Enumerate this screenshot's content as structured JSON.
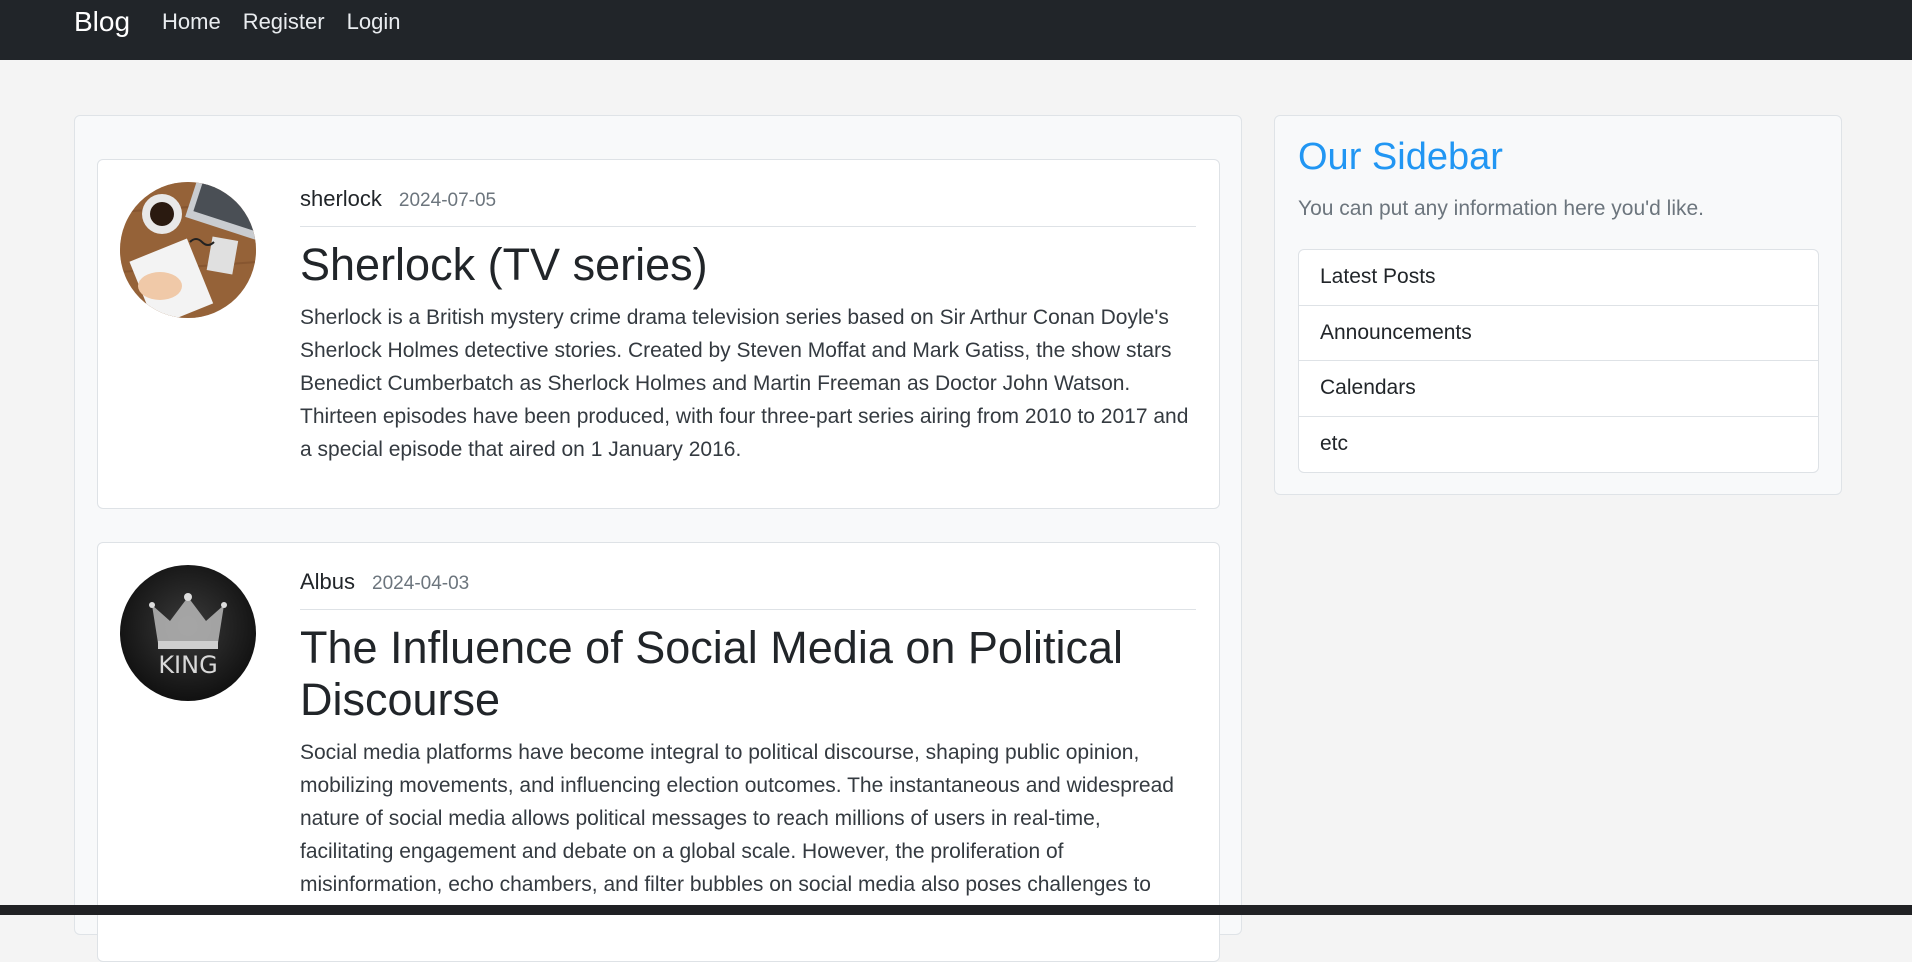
{
  "navbar": {
    "brand": "Blog",
    "links": [
      "Home",
      "Register",
      "Login"
    ]
  },
  "posts": [
    {
      "author": "sherlock",
      "date": "2024-07-05",
      "title": "Sherlock (TV series)",
      "content": "Sherlock is a British mystery crime drama television series based on Sir Arthur Conan Doyle's Sherlock Holmes detective stories. Created by Steven Moffat and Mark Gatiss, the show stars Benedict Cumberbatch as Sherlock Holmes and Martin Freeman as Doctor John Watson. Thirteen episodes have been produced, with four three-part series airing from 2010 to 2017 and a special episode that aired on 1 January 2016.",
      "avatar": "desk-photo"
    },
    {
      "author": "Albus",
      "date": "2024-04-03",
      "title": "The Influence of Social Media on Political Discourse",
      "content": "Social media platforms have become integral to political discourse, shaping public opinion, mobilizing movements, and influencing election outcomes. The instantaneous and widespread nature of social media allows political messages to reach millions of users in real-time, facilitating engagement and debate on a global scale. However, the proliferation of misinformation, echo chambers, and filter bubbles on social media also poses challenges to",
      "avatar": "crown-king-logo",
      "avatar_text": "KING"
    }
  ],
  "sidebar": {
    "title": "Our Sidebar",
    "text": "You can put any information here you'd like.",
    "items": [
      "Latest Posts",
      "Announcements",
      "Calendars",
      "etc"
    ]
  },
  "colors": {
    "navbar_bg": "#212529",
    "sidebar_title": "#2196f3",
    "page_bg": "#f4f4f4"
  }
}
